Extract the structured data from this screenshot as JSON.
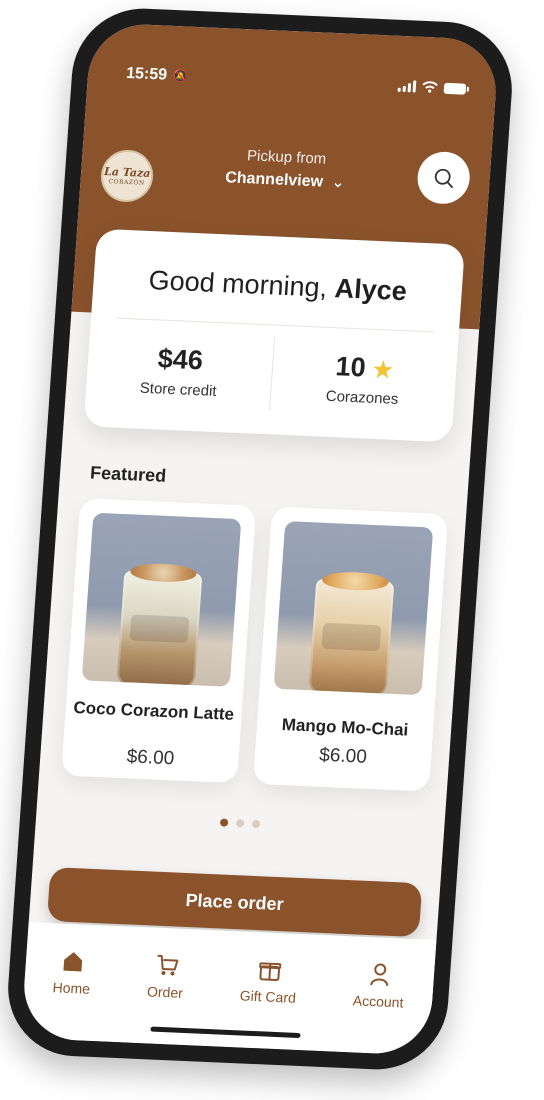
{
  "status_bar": {
    "time": "15:59"
  },
  "header": {
    "logo": {
      "line1": "La Taza",
      "line2": "CORAZÓN"
    },
    "pickup_label": "Pickup from",
    "pickup_location": "Channelview"
  },
  "greeting": {
    "text": "Good morning,",
    "name": "Alyce"
  },
  "stats": {
    "store_credit_value": "$46",
    "store_credit_label": "Store credit",
    "corazones_value": "10",
    "corazones_label": "Corazones"
  },
  "featured": {
    "title": "Featured",
    "items": [
      {
        "name": "Coco Corazon Latte",
        "price": "$6.00"
      },
      {
        "name": "Mango Mo-Chai",
        "price": "$6.00"
      }
    ]
  },
  "carousel": {
    "page_count": 3,
    "active_index": 0
  },
  "place_order_label": "Place order",
  "tabbar": [
    {
      "label": "Home",
      "icon": "home-icon",
      "active": true
    },
    {
      "label": "Order",
      "icon": "cart-icon",
      "active": false
    },
    {
      "label": "Gift Card",
      "icon": "gift-icon",
      "active": false
    },
    {
      "label": "Account",
      "icon": "user-icon",
      "active": false
    }
  ],
  "colors": {
    "brand": "#8a532c",
    "background": "#f5f4f2",
    "star": "#f1c232"
  }
}
